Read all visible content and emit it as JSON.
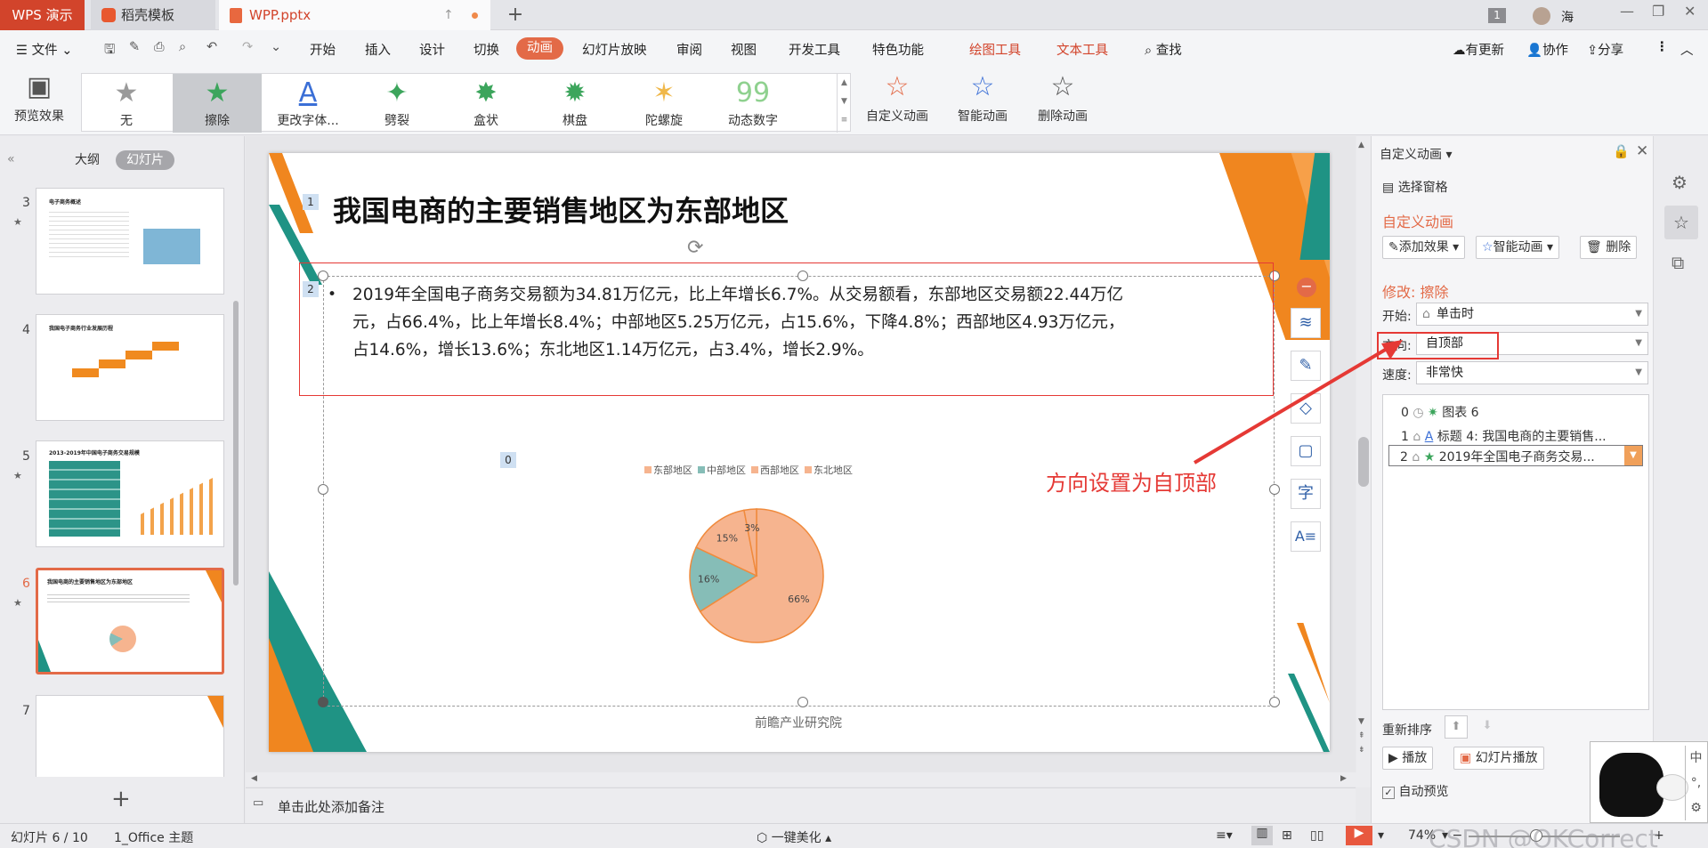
{
  "title_bar": {
    "app_tab": "WPS 演示",
    "templates_tab": "稻壳模板",
    "file_tab": "WPP.pptx",
    "page_badge": "1",
    "user": "海"
  },
  "menu": {
    "file": "文件",
    "items": [
      "开始",
      "插入",
      "设计",
      "切换",
      "动画",
      "幻灯片放映",
      "审阅",
      "视图",
      "开发工具",
      "特色功能"
    ],
    "drawing_tools": "绘图工具",
    "text_tools": "文本工具",
    "search": "查找",
    "update": "有更新",
    "collab": "协作",
    "share": "分享"
  },
  "ribbon": {
    "preview": "预览效果",
    "effects": [
      "无",
      "擦除",
      "更改字体...",
      "劈裂",
      "盒状",
      "棋盘",
      "陀螺旋",
      "动态数字"
    ],
    "custom_anim": "自定义动画",
    "smart_anim": "智能动画",
    "delete_anim": "删除动画"
  },
  "left_panel": {
    "outline_tab": "大纲",
    "slides_tab": "幻灯片",
    "slide_numbers": [
      "3",
      "4",
      "5",
      "6",
      "7"
    ],
    "thumb3_title": "电子商务概述",
    "thumb4_title": "我国电子商务行业发展历程",
    "thumb5_title": "2013-2019年中国电子商务交易规模",
    "thumb6_title": "我国电商的主要销售地区为东部地区",
    "add_slide": "+"
  },
  "slide": {
    "title_marker": "1",
    "title": "我国电商的主要销售地区为东部地区",
    "body_marker": "2",
    "body_line1": "2019年全国电子商务交易额为34.81万亿元，比上年增长6.7%。从交易额看，东部地区交易额22.44万亿",
    "body_line2": "元，占66.4%，比上年增长8.4%；中部地区5.25万亿元，占15.6%，下降4.8%；西部地区4.93万亿元，",
    "body_line3": "占14.6%，增长13.6%；东北地区1.14万亿元，占3.4%，增长2.9%。",
    "chart_marker": "0",
    "source": "前瞻产业研究院"
  },
  "chart_data": {
    "type": "pie",
    "categories": [
      "东部地区",
      "中部地区",
      "西部地区",
      "东北地区"
    ],
    "values": [
      66,
      16,
      15,
      3
    ],
    "labels": [
      "66%",
      "16%",
      "15%",
      "3%"
    ],
    "colors": [
      "#f6b48f",
      "#86bdb7",
      "#f6b48f",
      "#f6b48f"
    ],
    "legend_position": "top"
  },
  "notes": {
    "placeholder": "单击此处添加备注"
  },
  "right_panel": {
    "title": "自定义动画",
    "select_pane": "选择窗格",
    "section_title": "自定义动画",
    "add_effect": "添加效果",
    "smart_anim": "智能动画",
    "delete": "删除",
    "modify_title": "修改: 擦除",
    "start_label": "开始:",
    "start_value": "单击时",
    "direction_label": "方向:",
    "direction_value": "自顶部",
    "speed_label": "速度:",
    "speed_value": "非常快",
    "anim_items": [
      {
        "num": "0",
        "text": "图表 6"
      },
      {
        "num": "1",
        "text": "标题 4: 我国电商的主要销售..."
      },
      {
        "num": "2",
        "text": "2019年全国电子商务交易..."
      }
    ],
    "reorder": "重新排序",
    "play": "播放",
    "slideshow": "幻灯片播放",
    "auto_preview": "自动预览"
  },
  "annotation": {
    "text": "方向设置为自顶部"
  },
  "status_bar": {
    "slide_info": "幻灯片 6 / 10",
    "theme": "1_Office 主题",
    "beautify": "一键美化",
    "zoom": "74%",
    "watermark": "CSDN @OKCorrect"
  },
  "colors": {
    "accent_red": "#d2442b",
    "anim_tab": "#e36a47",
    "orange": "#f0861f",
    "teal": "#1f9384",
    "annotation_red": "#e53935"
  }
}
